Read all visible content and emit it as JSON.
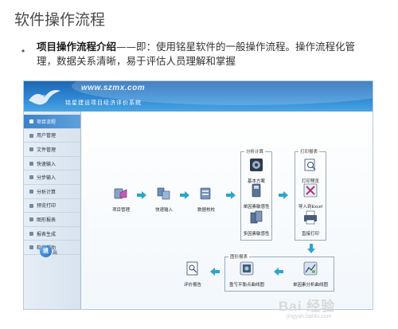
{
  "slide": {
    "title": "软件操作流程",
    "bullet_bold": "项目操作流程介绍",
    "bullet_rest": "——即：使用铭星软件的一般操作流程。操作流程化管理，数据关系清晰，易于评估人员理解和掌握"
  },
  "app": {
    "url": "www.szmx.com",
    "system_title": "铭星建设项目经济评价系统",
    "menu": [
      {
        "label": "项目流程"
      },
      {
        "label": "用户管理"
      },
      {
        "label": "文件管理"
      },
      {
        "label": "快速输入"
      },
      {
        "label": "分步输入"
      },
      {
        "label": "分析计算"
      },
      {
        "label": "预览打印"
      },
      {
        "label": "图形报表"
      },
      {
        "label": "报表生成"
      },
      {
        "label": "软件帮助"
      }
    ],
    "exit_label": "出",
    "exit_icon_text": "退",
    "flow": {
      "project_manage": "项目管理",
      "quick_input": "快速输入",
      "data_check": "数据核校",
      "group_analysis": "分析计算",
      "basic_plan": "基本方案",
      "single_factor": "单因素敏感性",
      "multi_factor": "多因素敏感性",
      "group_print": "打印报表",
      "print_preview": "打印预览",
      "import_excel": "导入到Excel",
      "direct_print": "直接打印",
      "group_chart": "图形报表",
      "breakeven_chart": "盈亏平衡点曲线图",
      "single_factor_chart": "单因素分析曲线图",
      "eval_report": "评价报告"
    }
  },
  "watermark": {
    "text": "Bai 经验",
    "sub": "jingyan.baidu.com"
  },
  "colors": {
    "banner": "#2f87d2",
    "active_menu": "#3b82c8",
    "arrow": "#2aa6c8"
  }
}
